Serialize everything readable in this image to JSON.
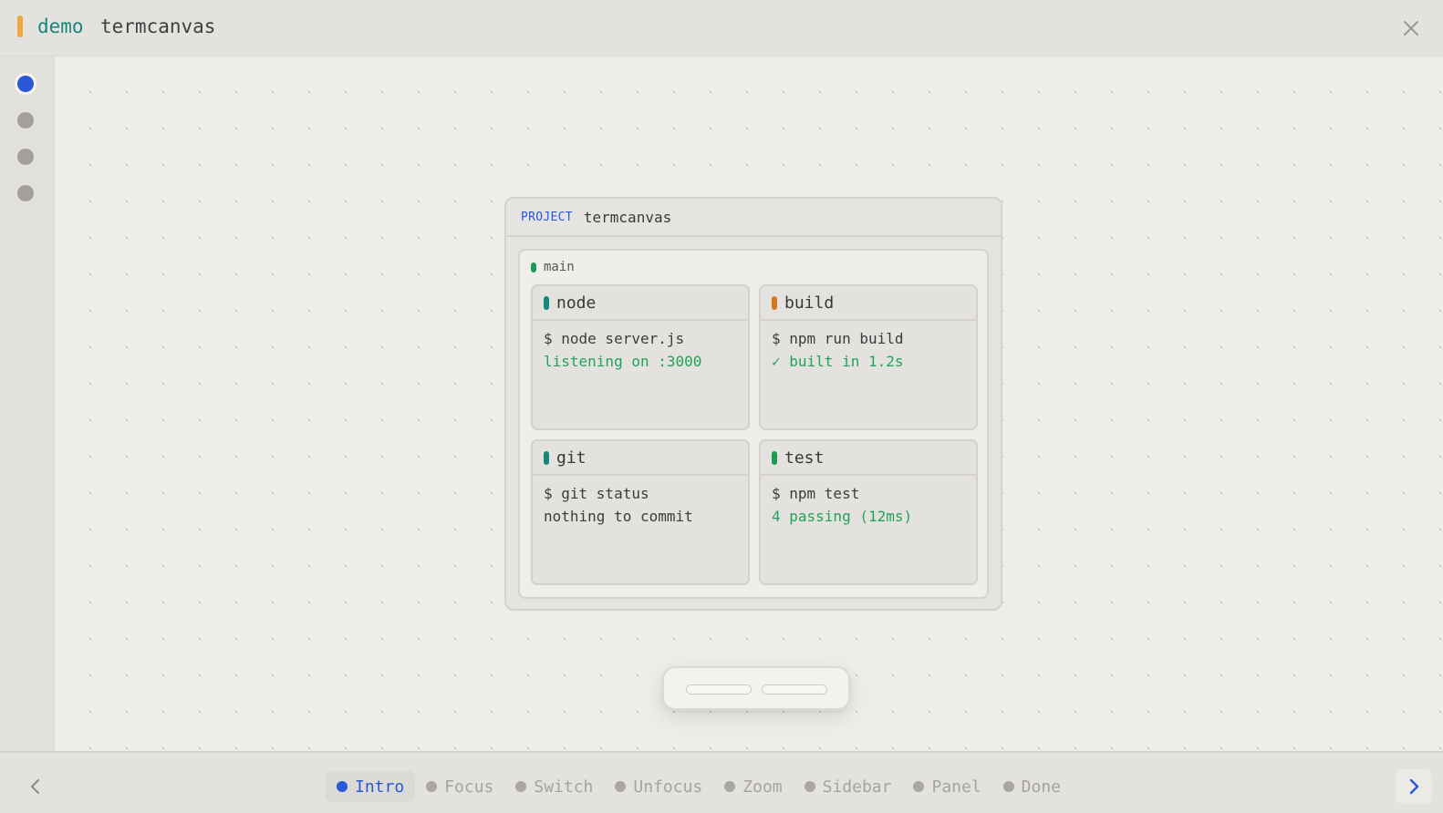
{
  "header": {
    "workspace_label": "demo",
    "title": "termcanvas"
  },
  "rail": {
    "items": [
      {
        "name": "rail-item-1",
        "active": true
      },
      {
        "name": "rail-item-2",
        "active": false
      },
      {
        "name": "rail-item-3",
        "active": false
      },
      {
        "name": "rail-item-4",
        "active": false
      }
    ]
  },
  "project": {
    "tag": "PROJECT",
    "name": "termcanvas",
    "worktree": {
      "label": "main",
      "terminals": [
        {
          "name": "node",
          "command": "$ node server.js",
          "output": "listening on :3000",
          "output_style": "green",
          "mark_color": "#17877a"
        },
        {
          "name": "build",
          "command": "$ npm run build",
          "output": "✓ built in 1.2s",
          "output_style": "green",
          "mark_color": "#d7761f"
        },
        {
          "name": "git",
          "command": "$ git status",
          "output": "nothing to commit",
          "output_style": "plain",
          "mark_color": "#17877a"
        },
        {
          "name": "test",
          "command": "$ npm test",
          "output": "4 passing (12ms)",
          "output_style": "green",
          "mark_color": "#1e9a52"
        }
      ]
    }
  },
  "tour": {
    "steps": [
      "Intro",
      "Focus",
      "Switch",
      "Unfocus",
      "Zoom",
      "Sidebar",
      "Panel",
      "Done"
    ],
    "active_step": "Intro"
  },
  "colors": {
    "accent": "#2a57d6",
    "brand": "#17877a",
    "success": "#22a25a",
    "workspace_marker": "#f0a83c"
  },
  "icons": {
    "close": "close-icon",
    "prev": "chevron-left-icon",
    "next": "chevron-right-icon"
  }
}
